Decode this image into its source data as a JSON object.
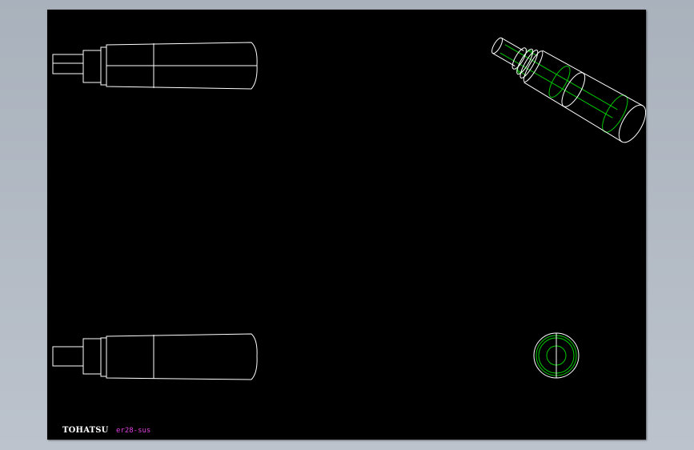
{
  "drawing": {
    "brand_text": "TOHATSU",
    "part_label": "er28-sus"
  },
  "colors": {
    "background": "#b0b8c2",
    "sheet": "#000000",
    "outline": "#ffffff",
    "hidden_edges": "#00c800",
    "label": "#e040e0"
  },
  "icons": {
    "front_view": "handle-front-view",
    "bottom_view": "handle-bottom-view",
    "iso_view": "handle-isometric-view",
    "end_view": "handle-end-view"
  }
}
